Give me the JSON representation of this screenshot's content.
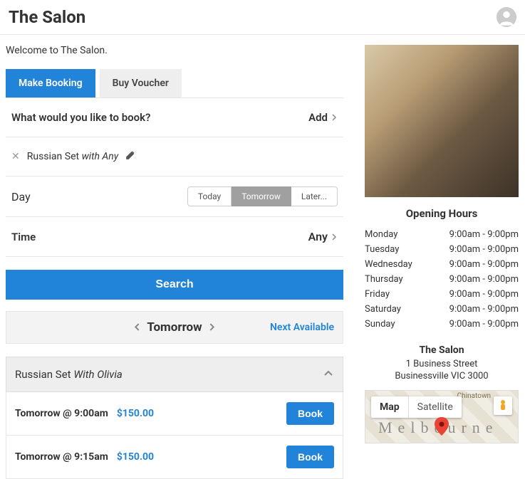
{
  "header": {
    "title": "The Salon"
  },
  "welcome": "Welcome to The Salon.",
  "tabs": {
    "make_booking": "Make Booking",
    "buy_voucher": "Buy Voucher"
  },
  "booking": {
    "question": "What would you like to book?",
    "add_label": "Add",
    "service_name": "Russian Set",
    "service_with": "with Any",
    "day_label": "Day",
    "day_options": {
      "today": "Today",
      "tomorrow": "Tomorrow",
      "later": "Later..."
    },
    "time_label": "Time",
    "time_value": "Any",
    "search_label": "Search"
  },
  "results": {
    "date_heading": "Tomorrow",
    "next_available": "Next Available",
    "group_service": "Russian Set",
    "group_with": "With Olivia",
    "slots": [
      {
        "when": "Tomorrow @ 9:00am",
        "price": "$150.00",
        "book": "Book"
      },
      {
        "when": "Tomorrow @ 9:15am",
        "price": "$150.00",
        "book": "Book"
      }
    ]
  },
  "sidebar": {
    "hours_title": "Opening Hours",
    "hours": [
      {
        "day": "Monday",
        "time": "9:00am - 9:00pm"
      },
      {
        "day": "Tuesday",
        "time": "9:00am - 9:00pm"
      },
      {
        "day": "Wednesday",
        "time": "9:00am - 9:00pm"
      },
      {
        "day": "Thursday",
        "time": "9:00am - 9:00pm"
      },
      {
        "day": "Friday",
        "time": "9:00am - 9:00pm"
      },
      {
        "day": "Saturday",
        "time": "9:00am - 9:00pm"
      },
      {
        "day": "Sunday",
        "time": "9:00am - 9:00pm"
      }
    ],
    "address": {
      "name": "The Salon",
      "street": "1 Business Street",
      "city": "Businessville VIC 3000"
    },
    "map": {
      "map_label": "Map",
      "satellite_label": "Satellite",
      "city_hint": "Melbourne",
      "district": "Chinatown"
    }
  }
}
